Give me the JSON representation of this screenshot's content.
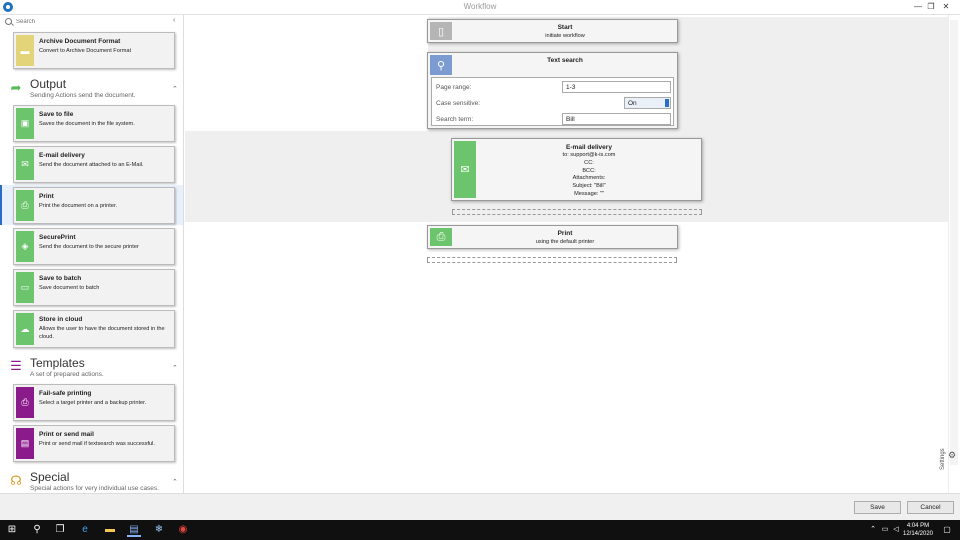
{
  "window": {
    "title": "Workflow",
    "minimize": "—",
    "restore": "❐",
    "close": "✕"
  },
  "sidebar": {
    "search_placeholder": "Search",
    "collapse_glyph": "‹",
    "top_item": {
      "title": "Archive Document Format",
      "desc": "Convert to Archive Document Format",
      "color": "#e3d47a"
    },
    "output": {
      "title": "Output",
      "subtitle": "Sending Actions send the document.",
      "chevron": "⌃",
      "items": [
        {
          "title": "Save to file",
          "desc": "Saves the document in the file system.",
          "icon": "save-icon"
        },
        {
          "title": "E-mail delivery",
          "desc": "Send the document attached to an E-Mail.",
          "icon": "mail-icon"
        },
        {
          "title": "Print",
          "desc": "Print the document on a printer.",
          "icon": "printer-icon"
        },
        {
          "title": "SecurePrint",
          "desc": "Send the document to the secure printer",
          "icon": "shield-icon"
        },
        {
          "title": "Save to batch",
          "desc": "Save document to batch",
          "icon": "tray-icon"
        },
        {
          "title": "Store in cloud",
          "desc": "Allows the user to have the document stored in the cloud.",
          "icon": "cloud-icon"
        }
      ]
    },
    "templates": {
      "title": "Templates",
      "subtitle": "A set of prepared actions.",
      "chevron": "⌃",
      "items": [
        {
          "title": "Fail-safe printing",
          "desc": "Select a target printer and a backup printer."
        },
        {
          "title": "Print or send mail",
          "desc": "Print or send mail if textsearch was successful."
        }
      ]
    },
    "special": {
      "title": "Special",
      "subtitle": "Special actions for very individual use cases.",
      "chevron": "⌃"
    }
  },
  "workflow": {
    "start": {
      "title": "Start",
      "sub": "initiate workflow"
    },
    "text_search": {
      "title": "Text search",
      "fields": {
        "page_range_label": "Page range:",
        "page_range": "1-3",
        "case_label": "Case sensitive:",
        "case_value": "On",
        "term_label": "Search term:",
        "term": "Bill"
      }
    },
    "email": {
      "title": "E-mail delivery",
      "lines": [
        "to: support@k-is.com",
        "CC:",
        "BCC:",
        "Attachments:",
        "Subject: \"Bill\"",
        "Message: \"\""
      ]
    },
    "print": {
      "title": "Print",
      "sub": "using the default printer"
    }
  },
  "settings_label": "Settings",
  "footer": {
    "save": "Save",
    "cancel": "Cancel"
  },
  "taskbar": {
    "time": "4:04 PM",
    "date": "12/14/2020"
  },
  "colors": {
    "green": "#6cc46c",
    "purple": "#8b1a8b",
    "blue_node": "#7b9bd1",
    "gray_node": "#b5b5b5",
    "accent": "#2b6cc4"
  }
}
